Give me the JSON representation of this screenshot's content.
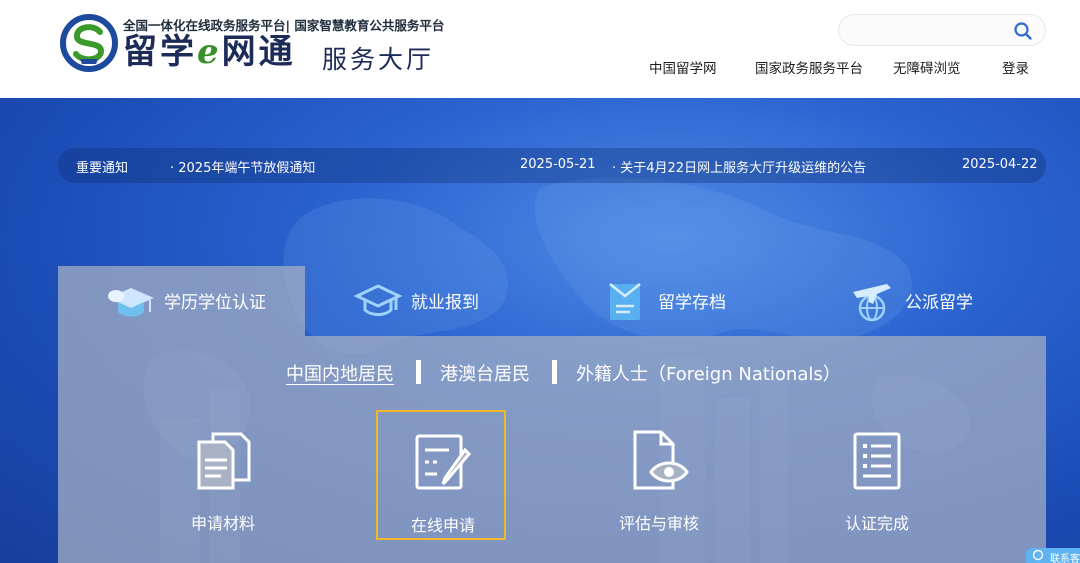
{
  "header": {
    "tagline": "全国一体化在线政务服务平台| 国家智慧教育公共服务平台",
    "brand_part1": "留学",
    "brand_e": "e",
    "brand_part2": "网通",
    "brand_sub": "服务大厅",
    "search_placeholder": "",
    "nav": [
      "中国留学网",
      "国家政务服务平台",
      "无障碍浏览",
      "登录"
    ]
  },
  "notices": {
    "label": "重要通知",
    "items": [
      {
        "title": "2025年端午节放假通知",
        "date": "2025-05-21"
      },
      {
        "title": "关于4月22日网上服务大厅升级运维的公告",
        "date": "2025-04-22"
      }
    ]
  },
  "tabs": [
    {
      "label": "学历学位认证",
      "icon": "graduation-cap-icon",
      "active": true
    },
    {
      "label": "就业报到",
      "icon": "mortarboard-icon",
      "active": false
    },
    {
      "label": "留学存档",
      "icon": "archive-document-icon",
      "active": false
    },
    {
      "label": "公派留学",
      "icon": "airplane-globe-icon",
      "active": false
    }
  ],
  "resident_tabs": [
    "中国内地居民",
    "港澳台居民",
    "外籍人士（Foreign Nationals）"
  ],
  "steps": [
    {
      "label": "申请材料",
      "icon": "documents-icon"
    },
    {
      "label": "在线申请",
      "icon": "edit-form-icon"
    },
    {
      "label": "评估与审核",
      "icon": "document-review-icon"
    },
    {
      "label": "认证完成",
      "icon": "checklist-icon"
    }
  ],
  "contact_label": "联系客",
  "colors": {
    "brand_navy": "#1d2b58",
    "hero_blue": "#2a63cf",
    "active_step_border": "#f0b92c",
    "contact_blue": "#5fb3f1"
  }
}
